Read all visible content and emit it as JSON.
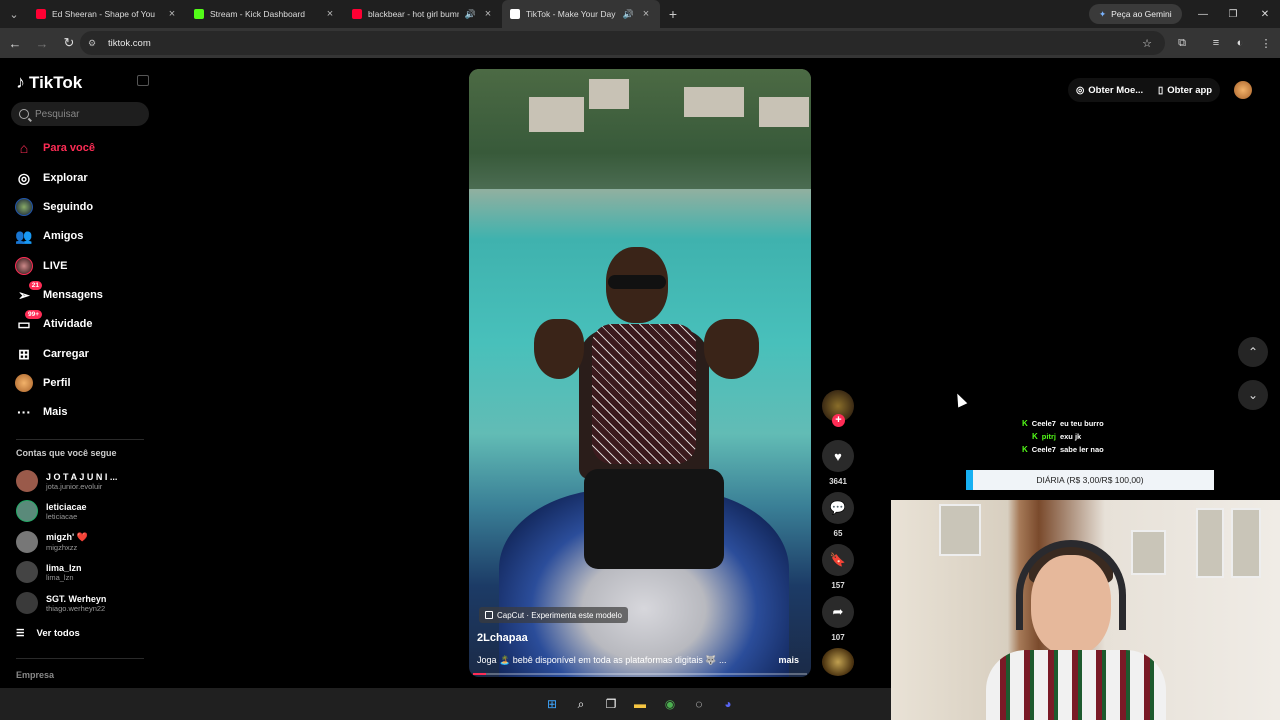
{
  "browser": {
    "tabs": [
      {
        "title": "Ed Sheeran - Shape of You",
        "favicon_color": "#ff0033",
        "active": false
      },
      {
        "title": "Stream - Kick Dashboard",
        "favicon_color": "#53fc18",
        "active": false
      },
      {
        "title": "blackbear - hot girl bumme",
        "favicon_color": "#ff0033",
        "active": false
      },
      {
        "title": "TikTok - Make Your Day",
        "favicon_color": "#ffffff",
        "active": true
      }
    ],
    "gemini_label": "Peça ao Gemini",
    "url": "tiktok.com"
  },
  "sidebar": {
    "logo_text": "TikTok",
    "search_placeholder": "Pesquisar",
    "nav": [
      {
        "label": "Para você",
        "icon": "home-icon",
        "active": true
      },
      {
        "label": "Explorar",
        "icon": "compass-icon"
      },
      {
        "label": "Seguindo",
        "icon": "following-avatar-icon"
      },
      {
        "label": "Amigos",
        "icon": "friends-icon"
      },
      {
        "label": "LIVE",
        "icon": "live-avatar-icon"
      },
      {
        "label": "Mensagens",
        "icon": "messages-icon",
        "badge": "21"
      },
      {
        "label": "Atividade",
        "icon": "activity-icon",
        "badge": "99+"
      },
      {
        "label": "Carregar",
        "icon": "upload-icon"
      },
      {
        "label": "Perfil",
        "icon": "profile-avatar-icon"
      },
      {
        "label": "Mais",
        "icon": "more-icon"
      }
    ],
    "following_title": "Contas que você segue",
    "following": [
      {
        "name": "J O T A  J U N I ...",
        "handle": "jota.junior.evoluir",
        "color": "#9a5a4a"
      },
      {
        "name": "leticiacae",
        "handle": "leticiacae",
        "color": "#5a8a7a"
      },
      {
        "name": "migzh' ❤️",
        "handle": "migzhxzz",
        "color": "#777"
      },
      {
        "name": "lima_lzn",
        "handle": "lima_lzn",
        "color": "#444"
      },
      {
        "name": "SGT. Werheyn",
        "handle": "thiago.werheyn22",
        "color": "#3a3a3a"
      }
    ],
    "see_all": "Ver todos",
    "company": "Empresa"
  },
  "video": {
    "capcut_label": "CapCut · Experimenta este modelo",
    "author": "2Lchapaa",
    "caption": "Joga 🏝️ bebê disponível em toda as plataformas digitais 🐺 ...",
    "more": "mais",
    "progress": 0.04
  },
  "actions": {
    "likes": "3641",
    "comments": "65",
    "saves": "157",
    "shares": "107"
  },
  "topbar": {
    "coins_label": "Obter Moe...",
    "app_label": "Obter app"
  },
  "stream": {
    "chat": [
      {
        "user": "Ceele7",
        "message": "eu teu burro",
        "user_color": "#ffffff"
      },
      {
        "user": "pitrj",
        "message": "exu jk",
        "user_color": "#53fc18"
      },
      {
        "user": "Ceele7",
        "message": "sabe ler nao",
        "user_color": "#ffffff"
      }
    ],
    "goal_label": "DIÁRIA (R$ 3,00/R$ 100,00)",
    "goal_progress": 0.03
  },
  "taskbar": {
    "icons": [
      "windows-start-icon",
      "search-icon",
      "task-view-icon",
      "file-explorer-icon",
      "chrome-icon",
      "obs-icon",
      "discord-icon"
    ]
  }
}
